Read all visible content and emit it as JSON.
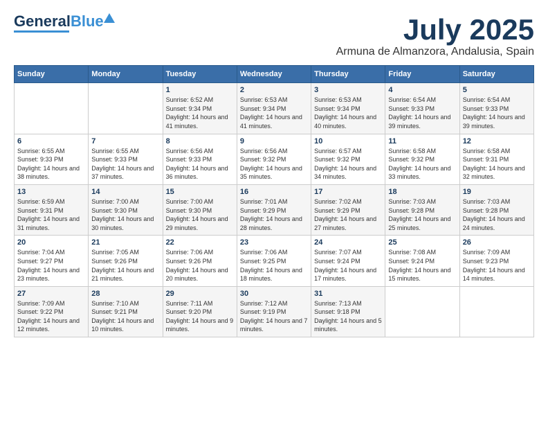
{
  "header": {
    "logo_line1": "General",
    "logo_line2": "Blue",
    "month": "July 2025",
    "location": "Armuna de Almanzora, Andalusia, Spain"
  },
  "days_of_week": [
    "Sunday",
    "Monday",
    "Tuesday",
    "Wednesday",
    "Thursday",
    "Friday",
    "Saturday"
  ],
  "weeks": [
    [
      {
        "day": "",
        "info": ""
      },
      {
        "day": "",
        "info": ""
      },
      {
        "day": "1",
        "info": "Sunrise: 6:52 AM\nSunset: 9:34 PM\nDaylight: 14 hours and 41 minutes."
      },
      {
        "day": "2",
        "info": "Sunrise: 6:53 AM\nSunset: 9:34 PM\nDaylight: 14 hours and 41 minutes."
      },
      {
        "day": "3",
        "info": "Sunrise: 6:53 AM\nSunset: 9:34 PM\nDaylight: 14 hours and 40 minutes."
      },
      {
        "day": "4",
        "info": "Sunrise: 6:54 AM\nSunset: 9:33 PM\nDaylight: 14 hours and 39 minutes."
      },
      {
        "day": "5",
        "info": "Sunrise: 6:54 AM\nSunset: 9:33 PM\nDaylight: 14 hours and 39 minutes."
      }
    ],
    [
      {
        "day": "6",
        "info": "Sunrise: 6:55 AM\nSunset: 9:33 PM\nDaylight: 14 hours and 38 minutes."
      },
      {
        "day": "7",
        "info": "Sunrise: 6:55 AM\nSunset: 9:33 PM\nDaylight: 14 hours and 37 minutes."
      },
      {
        "day": "8",
        "info": "Sunrise: 6:56 AM\nSunset: 9:33 PM\nDaylight: 14 hours and 36 minutes."
      },
      {
        "day": "9",
        "info": "Sunrise: 6:56 AM\nSunset: 9:32 PM\nDaylight: 14 hours and 35 minutes."
      },
      {
        "day": "10",
        "info": "Sunrise: 6:57 AM\nSunset: 9:32 PM\nDaylight: 14 hours and 34 minutes."
      },
      {
        "day": "11",
        "info": "Sunrise: 6:58 AM\nSunset: 9:32 PM\nDaylight: 14 hours and 33 minutes."
      },
      {
        "day": "12",
        "info": "Sunrise: 6:58 AM\nSunset: 9:31 PM\nDaylight: 14 hours and 32 minutes."
      }
    ],
    [
      {
        "day": "13",
        "info": "Sunrise: 6:59 AM\nSunset: 9:31 PM\nDaylight: 14 hours and 31 minutes."
      },
      {
        "day": "14",
        "info": "Sunrise: 7:00 AM\nSunset: 9:30 PM\nDaylight: 14 hours and 30 minutes."
      },
      {
        "day": "15",
        "info": "Sunrise: 7:00 AM\nSunset: 9:30 PM\nDaylight: 14 hours and 29 minutes."
      },
      {
        "day": "16",
        "info": "Sunrise: 7:01 AM\nSunset: 9:29 PM\nDaylight: 14 hours and 28 minutes."
      },
      {
        "day": "17",
        "info": "Sunrise: 7:02 AM\nSunset: 9:29 PM\nDaylight: 14 hours and 27 minutes."
      },
      {
        "day": "18",
        "info": "Sunrise: 7:03 AM\nSunset: 9:28 PM\nDaylight: 14 hours and 25 minutes."
      },
      {
        "day": "19",
        "info": "Sunrise: 7:03 AM\nSunset: 9:28 PM\nDaylight: 14 hours and 24 minutes."
      }
    ],
    [
      {
        "day": "20",
        "info": "Sunrise: 7:04 AM\nSunset: 9:27 PM\nDaylight: 14 hours and 23 minutes."
      },
      {
        "day": "21",
        "info": "Sunrise: 7:05 AM\nSunset: 9:26 PM\nDaylight: 14 hours and 21 minutes."
      },
      {
        "day": "22",
        "info": "Sunrise: 7:06 AM\nSunset: 9:26 PM\nDaylight: 14 hours and 20 minutes."
      },
      {
        "day": "23",
        "info": "Sunrise: 7:06 AM\nSunset: 9:25 PM\nDaylight: 14 hours and 18 minutes."
      },
      {
        "day": "24",
        "info": "Sunrise: 7:07 AM\nSunset: 9:24 PM\nDaylight: 14 hours and 17 minutes."
      },
      {
        "day": "25",
        "info": "Sunrise: 7:08 AM\nSunset: 9:24 PM\nDaylight: 14 hours and 15 minutes."
      },
      {
        "day": "26",
        "info": "Sunrise: 7:09 AM\nSunset: 9:23 PM\nDaylight: 14 hours and 14 minutes."
      }
    ],
    [
      {
        "day": "27",
        "info": "Sunrise: 7:09 AM\nSunset: 9:22 PM\nDaylight: 14 hours and 12 minutes."
      },
      {
        "day": "28",
        "info": "Sunrise: 7:10 AM\nSunset: 9:21 PM\nDaylight: 14 hours and 10 minutes."
      },
      {
        "day": "29",
        "info": "Sunrise: 7:11 AM\nSunset: 9:20 PM\nDaylight: 14 hours and 9 minutes."
      },
      {
        "day": "30",
        "info": "Sunrise: 7:12 AM\nSunset: 9:19 PM\nDaylight: 14 hours and 7 minutes."
      },
      {
        "day": "31",
        "info": "Sunrise: 7:13 AM\nSunset: 9:18 PM\nDaylight: 14 hours and 5 minutes."
      },
      {
        "day": "",
        "info": ""
      },
      {
        "day": "",
        "info": ""
      }
    ]
  ]
}
